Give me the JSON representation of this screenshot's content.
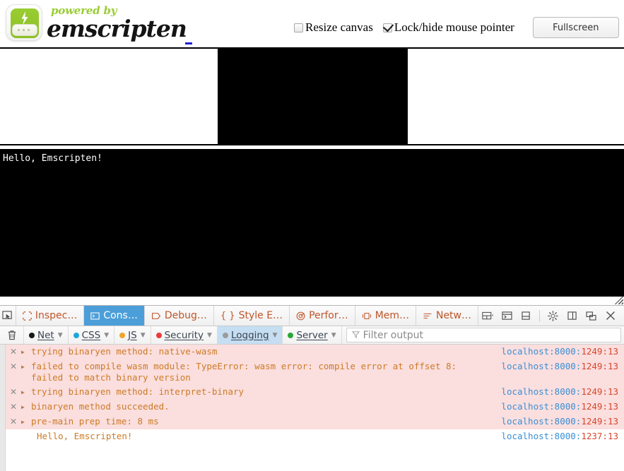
{
  "page": {
    "logo": {
      "icon_name": "emscripten-logo",
      "powered_by": "powered by",
      "wordmark": "emscripten"
    },
    "controls": {
      "resize_canvas_label": "Resize canvas",
      "resize_canvas_checked": false,
      "lock_pointer_label": "Lock/hide mouse pointer",
      "lock_pointer_checked": true,
      "fullscreen_label": "Fullscreen"
    },
    "output": {
      "value": "Hello, Emscripten!"
    }
  },
  "devtools": {
    "picker_icon": "element-picker-icon",
    "tabs": [
      {
        "label": "Inspec…",
        "icon": "inspector-icon",
        "active": false
      },
      {
        "label": "Cons…",
        "icon": "console-icon",
        "active": true
      },
      {
        "label": "Debug…",
        "icon": "debugger-icon",
        "active": false
      },
      {
        "label": "Style E…",
        "icon": "style-editor-icon",
        "active": false
      },
      {
        "label": "Perfor…",
        "icon": "performance-icon",
        "active": false
      },
      {
        "label": "Mem…",
        "icon": "memory-icon",
        "active": false
      },
      {
        "label": "Netw…",
        "icon": "network-icon",
        "active": false
      }
    ],
    "right_buttons": [
      {
        "icon": "responsive-layout-icon",
        "name": "select-iframe-button"
      },
      {
        "icon": "split-console-icon",
        "name": "split-console-button"
      },
      {
        "icon": "dock-bottom-icon",
        "name": "dock-bottom-button"
      },
      {
        "icon": "gear-icon",
        "name": "settings-button"
      },
      {
        "icon": "dock-side-icon",
        "name": "dock-side-button"
      },
      {
        "icon": "dock-window-icon",
        "name": "separate-window-button"
      },
      {
        "icon": "close-icon",
        "name": "close-devtools-button"
      }
    ],
    "filter_bar": {
      "trash_icon": "trash-icon",
      "buttons": [
        {
          "label": "Net",
          "color": "#1a1a1a",
          "active": false
        },
        {
          "label": "CSS",
          "color": "#21a6d8",
          "active": false
        },
        {
          "label": "JS",
          "color": "#f0a52b",
          "active": false
        },
        {
          "label": "Security",
          "color": "#ec3b3b",
          "active": false
        },
        {
          "label": "Logging",
          "color": "#9b9b9b",
          "active": true
        },
        {
          "label": "Server",
          "color": "#2aa637",
          "active": false
        }
      ],
      "filter_icon": "funnel-icon",
      "filter_placeholder": "Filter output",
      "filter_value": ""
    },
    "console_rows": [
      {
        "severity": "error",
        "message": "trying binaryen method: native-wasm",
        "source_host": "localhost:8000:",
        "source_loc": "1249:13"
      },
      {
        "severity": "error",
        "message": "failed to compile wasm module: TypeError: wasm error: compile error at offset 8: failed to match binary version",
        "source_host": "localhost:8000:",
        "source_loc": "1249:13"
      },
      {
        "severity": "error",
        "message": "trying binaryen method: interpret-binary",
        "source_host": "localhost:8000:",
        "source_loc": "1249:13"
      },
      {
        "severity": "error",
        "message": "binaryen method succeeded.",
        "source_host": "localhost:8000:",
        "source_loc": "1249:13"
      },
      {
        "severity": "error",
        "message": "pre-main prep time: 8 ms",
        "source_host": "localhost:8000:",
        "source_loc": "1249:13"
      },
      {
        "severity": "log",
        "message": "Hello, Emscripten!",
        "source_host": "localhost:8000:",
        "source_loc": "1237:13"
      }
    ]
  }
}
